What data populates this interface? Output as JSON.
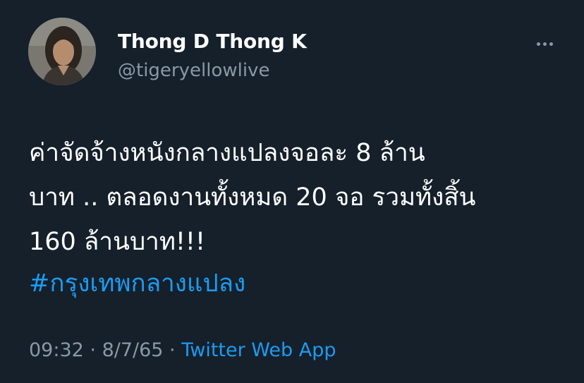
{
  "author": {
    "display_name": "Thong D Thong K",
    "handle": "@tigeryellowlive"
  },
  "more_icon": "more-horizontal-icon",
  "tweet": {
    "lines": [
      "ค่าจัดจ้างหนังกลางแปลงจอละ 8 ล้าน",
      "บาท .. ตลอดงานทั้งหมด 20 จอ  รวมทั้งสิ้น",
      "160 ล้านบาท!!!"
    ],
    "hashtag": "#กรุงเทพกลางแปลง"
  },
  "meta": {
    "time": "09:32",
    "separator": " · ",
    "date": "8/7/65",
    "source": "Twitter Web App"
  },
  "colors": {
    "background": "#15202b",
    "text": "#ffffff",
    "secondary": "#8b98a5",
    "accent": "#1d9bf0"
  }
}
